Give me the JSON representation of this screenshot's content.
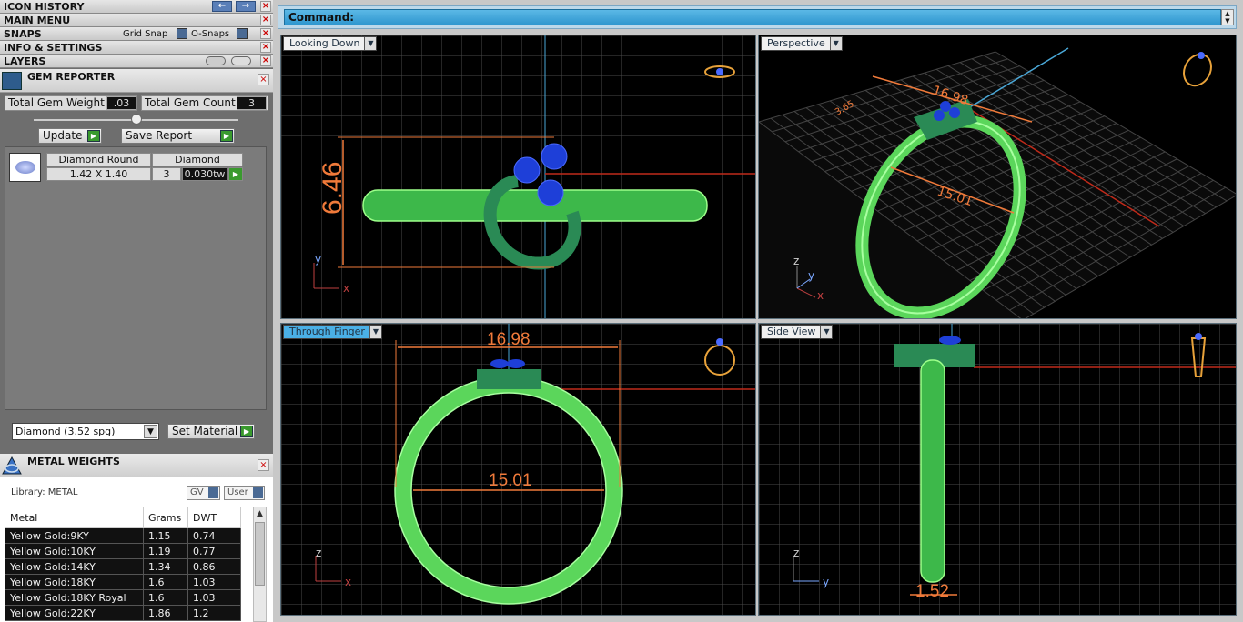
{
  "left_panel": {
    "icon_history": "ICON HISTORY",
    "main_menu": "MAIN MENU",
    "snaps": "SNAPS",
    "grid_snap": "Grid Snap",
    "o_snaps": "O-Snaps",
    "info_settings": "INFO & SETTINGS",
    "layers": "LAYERS"
  },
  "gem_reporter": {
    "title": "GEM REPORTER",
    "total_weight_label": "Total Gem Weight",
    "total_weight_value": ".03",
    "total_count_label": "Total Gem Count",
    "total_count_value": "3",
    "update_label": "Update",
    "save_report_label": "Save Report",
    "gem": {
      "shape": "Diamond Round",
      "type": "Diamond",
      "size": "1.42 X 1.40",
      "count": "3",
      "weight": "0.030tw"
    },
    "material_select": "Diamond    (3.52 spg)",
    "set_material_label": "Set Material"
  },
  "metal_weights": {
    "title": "METAL WEIGHTS",
    "library_label": "Library: METAL",
    "gv_label": "GV",
    "user_label": "User",
    "columns": [
      "Metal",
      "Grams",
      "DWT"
    ],
    "rows": [
      [
        "Yellow Gold:9KY",
        "1.15",
        "0.74"
      ],
      [
        "Yellow Gold:10KY",
        "1.19",
        "0.77"
      ],
      [
        "Yellow Gold:14KY",
        "1.34",
        "0.86"
      ],
      [
        "Yellow Gold:18KY",
        "1.6",
        "1.03"
      ],
      [
        "Yellow Gold:18KY Royal",
        "1.6",
        "1.03"
      ],
      [
        "Yellow Gold:22KY",
        "1.86",
        "1.2"
      ]
    ]
  },
  "command": {
    "label": "Command:"
  },
  "viewports": {
    "top_left": {
      "name": "Looking Down",
      "dim_height": "6.46",
      "axis_v": "y",
      "axis_h": "x"
    },
    "top_right": {
      "name": "Perspective",
      "dim_width": "16.98",
      "dim_inner": "15.01",
      "dim_side": "3.65",
      "axis_z": "z",
      "axis_y": "y",
      "axis_x": "x"
    },
    "bottom_left": {
      "name": "Through Finger",
      "dim_width": "16.98",
      "dim_inner": "15.01",
      "axis_v": "z",
      "axis_h": "x"
    },
    "bottom_right": {
      "name": "Side View",
      "dim_shank": "1.52",
      "axis_v": "z",
      "axis_h": "y"
    }
  },
  "colors": {
    "metal_green": "#5bd65b",
    "gem_blue": "#1e3fd8",
    "dim_orange": "#f07a3a",
    "grid": "#4a4a4a",
    "viewport_tab_active": "#4ab0e6"
  }
}
